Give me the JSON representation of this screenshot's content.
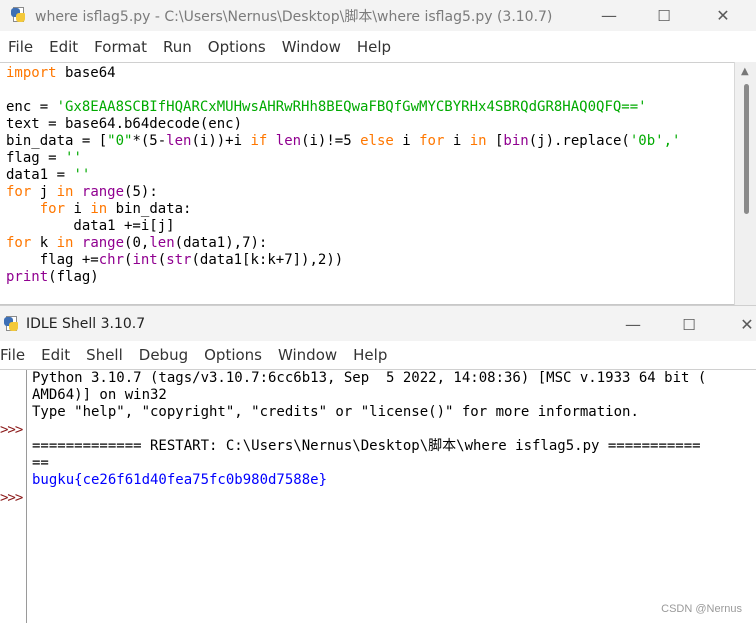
{
  "editor": {
    "title": "where isflag5.py - C:\\Users\\Nernus\\Desktop\\脚本\\where isflag5.py (3.10.7)",
    "menu": [
      "File",
      "Edit",
      "Format",
      "Run",
      "Options",
      "Window",
      "Help"
    ],
    "window_controls": {
      "minimize": "—",
      "maximize": "☐",
      "close": "✕"
    },
    "code": {
      "l1_kw": "import",
      "l1_rest": " base64",
      "l3_a": "enc = ",
      "l3_str": "'Gx8EAA8SCBIfHQARCxMUHwsAHRwRHh8BEQwaFBQfGwMYCBYRHx4SBRQdGR8HAQ0QFQ=='",
      "l4": "text = base64.b64decode(enc)",
      "l5_a": "bin_data = [",
      "l5_s1": "\"0\"",
      "l5_b": "*(5-",
      "l5_len1": "len",
      "l5_c": "(i))+i ",
      "l5_if": "if",
      "l5_sp1": " ",
      "l5_len2": "len",
      "l5_d": "(i)!=5 ",
      "l5_else": "else",
      "l5_e": " i ",
      "l5_for": "for",
      "l5_f": " i ",
      "l5_in": "in",
      "l5_g": " [",
      "l5_bin": "bin",
      "l5_h": "(j).replace(",
      "l5_s2": "'0b'",
      "l5_i": ",'",
      "l6_a": "flag = ",
      "l6_s": "''",
      "l7_a": "data1 = ",
      "l7_s": "''",
      "l8_for": "for",
      "l8_a": " j ",
      "l8_in": "in",
      "l8_sp": " ",
      "l8_range": "range",
      "l8_b": "(5):",
      "l9_ind": "    ",
      "l9_for": "for",
      "l9_a": " i ",
      "l9_in": "in",
      "l9_b": " bin_data:",
      "l10": "        data1 +=i[j]",
      "l11_for": "for",
      "l11_a": " k ",
      "l11_in": "in",
      "l11_sp": " ",
      "l11_range": "range",
      "l11_b": "(0,",
      "l11_len": "len",
      "l11_c": "(data1),7):",
      "l12_ind": "    flag +=",
      "l12_chr": "chr",
      "l12_p": "(",
      "l12_int": "int",
      "l12_p2": "(",
      "l12_str": "str",
      "l12_b": "(data1[k:k+7]),2))",
      "l13_print": "print",
      "l13_b": "(flag)"
    }
  },
  "shell": {
    "title": "IDLE Shell 3.10.7",
    "menu": [
      "File",
      "Edit",
      "Shell",
      "Debug",
      "Options",
      "Window",
      "Help"
    ],
    "window_controls": {
      "minimize": "—",
      "maximize": "☐",
      "close": "✕"
    },
    "prompt": ">>>",
    "banner_1": "Python 3.10.7 (tags/v3.10.7:6cc6b13, Sep  5 2022, 14:08:36) [MSC v.1933 64 bit (",
    "banner_2": "AMD64)] on win32",
    "banner_3": "Type \"help\", \"copyright\", \"credits\" or \"license()\" for more information.",
    "restart_1": "============= RESTART: C:\\Users\\Nernus\\Desktop\\脚本\\where isflag5.py ===========",
    "restart_2": "==",
    "output": "bugku{ce26f61d40fea75fc0b980d7588e}"
  },
  "watermark": "CSDN @Nernus"
}
